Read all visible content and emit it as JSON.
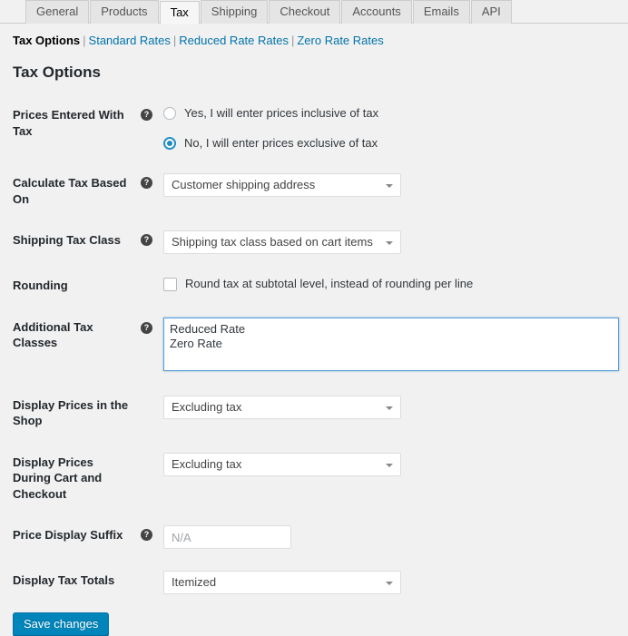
{
  "tabs": [
    {
      "label": "General",
      "active": false
    },
    {
      "label": "Products",
      "active": false
    },
    {
      "label": "Tax",
      "active": true
    },
    {
      "label": "Shipping",
      "active": false
    },
    {
      "label": "Checkout",
      "active": false
    },
    {
      "label": "Accounts",
      "active": false
    },
    {
      "label": "Emails",
      "active": false
    },
    {
      "label": "API",
      "active": false
    }
  ],
  "subnav": {
    "current": "Tax Options",
    "sep": "|",
    "links": [
      "Standard Rates",
      "Reduced Rate Rates",
      "Zero Rate Rates"
    ]
  },
  "page": {
    "title": "Tax Options"
  },
  "help_icon": "?",
  "fields": {
    "prices_entered_with_tax": {
      "label": "Prices Entered With Tax",
      "options": [
        {
          "label": "Yes, I will enter prices inclusive of tax",
          "checked": false
        },
        {
          "label": "No, I will enter prices exclusive of tax",
          "checked": true
        }
      ]
    },
    "calculate_tax_based_on": {
      "label": "Calculate Tax Based On",
      "value": "Customer shipping address"
    },
    "shipping_tax_class": {
      "label": "Shipping Tax Class",
      "value": "Shipping tax class based on cart items"
    },
    "rounding": {
      "label": "Rounding",
      "checkbox_label": "Round tax at subtotal level, instead of rounding per line",
      "checked": false
    },
    "additional_tax_classes": {
      "label": "Additional Tax Classes",
      "value": "Reduced Rate\nZero Rate"
    },
    "display_prices_shop": {
      "label": "Display Prices in the Shop",
      "value": "Excluding tax"
    },
    "display_prices_cart_checkout": {
      "label": "Display Prices During Cart and Checkout",
      "value": "Excluding tax"
    },
    "price_display_suffix": {
      "label": "Price Display Suffix",
      "value": "",
      "placeholder": "N/A"
    },
    "display_tax_totals": {
      "label": "Display Tax Totals",
      "value": "Itemized"
    }
  },
  "submit": {
    "label": "Save changes"
  },
  "colors": {
    "page_background": "#f1f1f1",
    "accent_link": "#0073aa",
    "button_primary": "#0085ba",
    "focus_border": "#5b9dd9",
    "radio_selected": "#1e8cbe"
  }
}
